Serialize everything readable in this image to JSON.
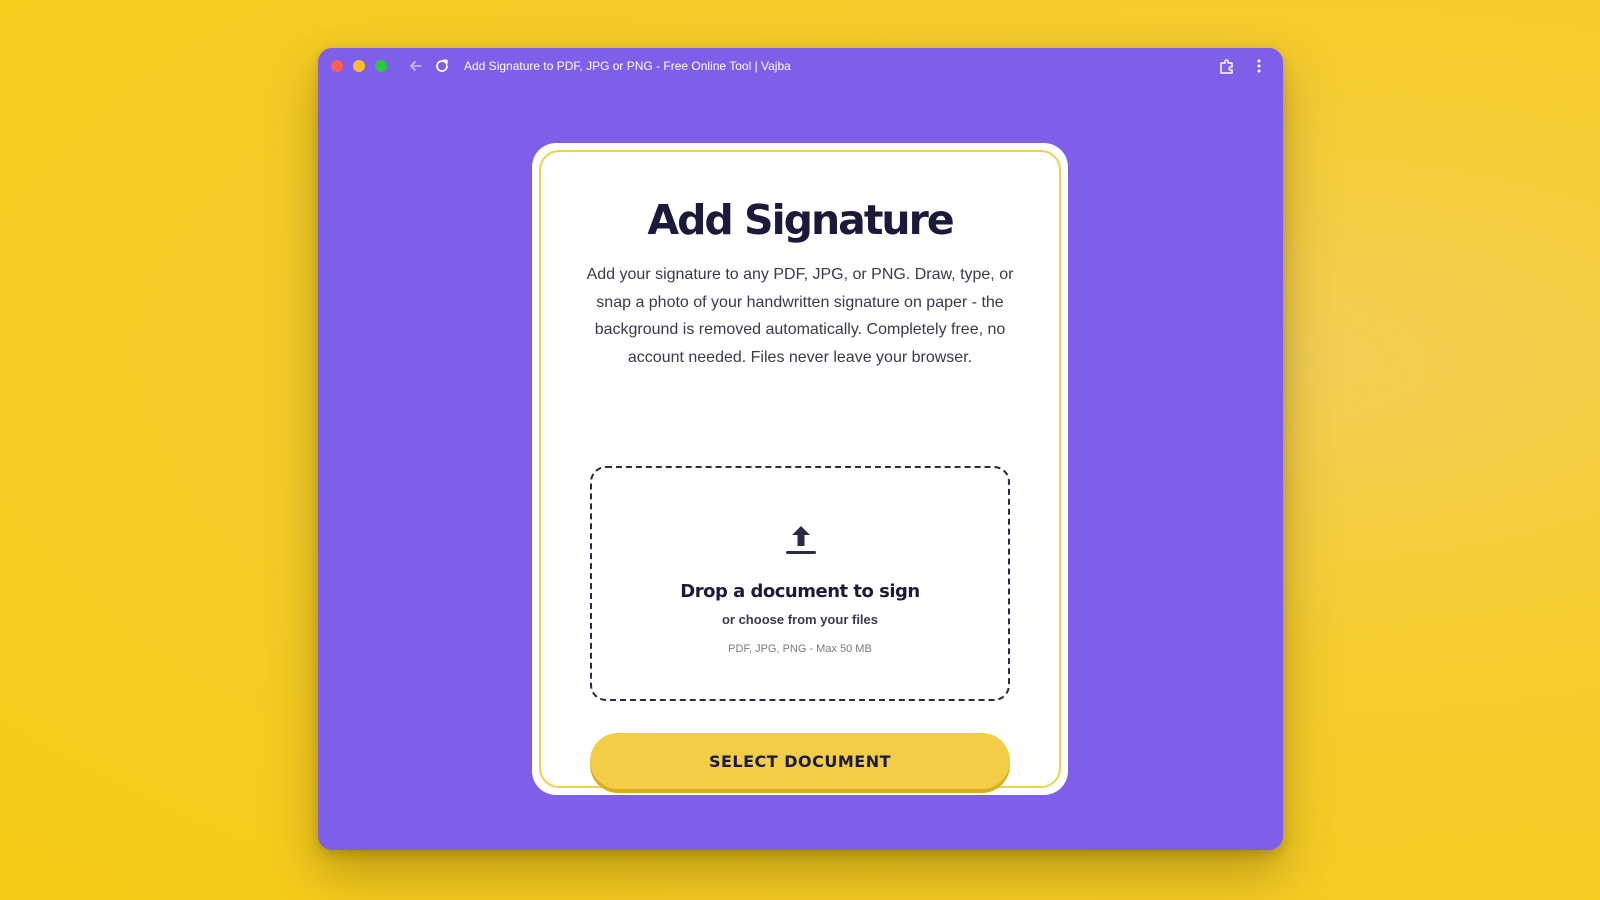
{
  "browser": {
    "tab_title": "Add Signature to PDF, JPG or PNG - Free Online Tool | Vajba",
    "icons": [
      "back-arrow-icon",
      "reload-icon",
      "extensions-icon",
      "more-menu-icon"
    ]
  },
  "card": {
    "title": "Add Signature",
    "description": "Add your signature to any PDF, JPG, or PNG. Draw, type, or snap a photo of your handwritten signature on paper - the background is removed automatically. Completely free, no account needed. Files never leave your browser.",
    "dropzone": {
      "icon": "upload-icon",
      "title": "Drop a document to sign",
      "subtitle": "or choose from your files",
      "formats": "PDF, JPG, PNG - Max 50 MB"
    },
    "button_label": "SELECT DOCUMENT"
  },
  "colors": {
    "background": "#f6cc17",
    "window": "#7f5fe9",
    "accent": "#f2cd45",
    "text_dark": "#1b1a3a"
  }
}
